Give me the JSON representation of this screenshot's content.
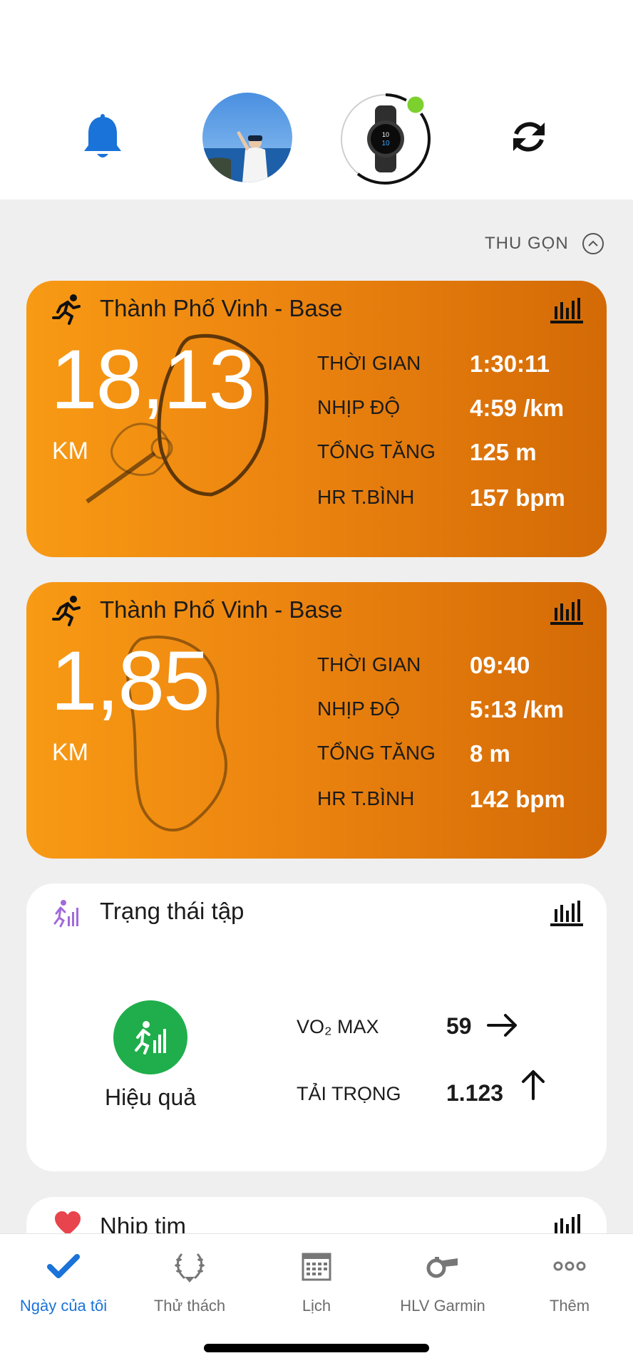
{
  "header": {
    "collapse_label": "THU GỌN"
  },
  "activities": [
    {
      "title": "Thành Phố Vinh - Base",
      "distance": "18,13",
      "unit": "KM",
      "stats": [
        {
          "label": "THỜI GIAN",
          "value": "1:30:11"
        },
        {
          "label": "NHỊP ĐỘ",
          "value": "4:59 /km"
        },
        {
          "label": "TỔNG TĂNG",
          "value": "125 m"
        },
        {
          "label": "HR T.BÌNH",
          "value": "157 bpm"
        }
      ]
    },
    {
      "title": "Thành Phố Vinh - Base",
      "distance": "1,85",
      "unit": "KM",
      "stats": [
        {
          "label": "THỜI GIAN",
          "value": "09:40"
        },
        {
          "label": "NHỊP ĐỘ",
          "value": "5:13 /km"
        },
        {
          "label": "TỔNG TĂNG",
          "value": "8 m"
        },
        {
          "label": "HR T.BÌNH",
          "value": "142 bpm"
        }
      ]
    }
  ],
  "training": {
    "title": "Trạng thái tập",
    "status": "Hiệu quả",
    "vo2_label": "VO₂ MAX",
    "vo2_value": "59",
    "load_label": "TẢI TRỌNG",
    "load_value": "1.123"
  },
  "heart_rate": {
    "title": "Nhịp tim"
  },
  "nav": [
    {
      "label": "Ngày của tôi",
      "icon": "check-icon"
    },
    {
      "label": "Thử thách",
      "icon": "laurel-icon"
    },
    {
      "label": "Lịch",
      "icon": "calendar-icon"
    },
    {
      "label": "HLV Garmin",
      "icon": "whistle-icon"
    },
    {
      "label": "Thêm",
      "icon": "more-icon"
    }
  ],
  "colors": {
    "accent_orange": "#f0890f",
    "brand_blue": "#1a73d8",
    "status_green": "#1fae4b",
    "connected_green": "#7cd12f"
  }
}
